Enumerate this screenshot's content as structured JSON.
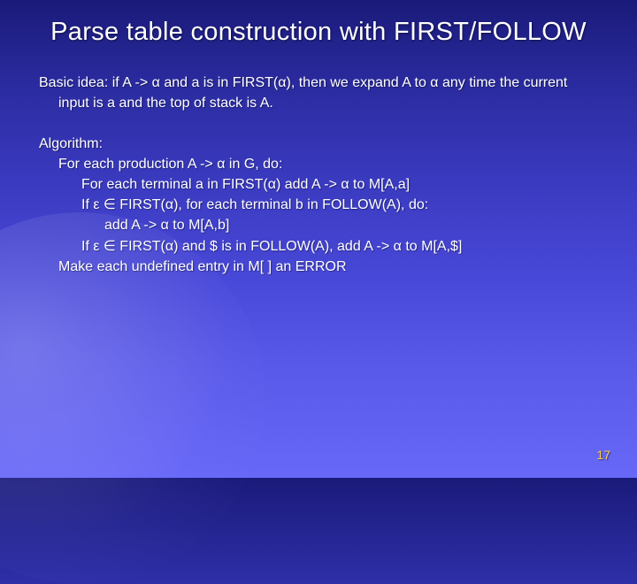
{
  "slide": {
    "title": "Parse table construction with FIRST/FOLLOW",
    "basic_idea": "Basic idea: if A -> α and a is in FIRST(α), then we expand A to α any time the current input is a and the top of stack is A.",
    "algorithm": {
      "heading": "Algorithm:",
      "line1": "For each production A -> α in G, do:",
      "line2": "For each terminal a in FIRST(α) add A -> α to M[A,a]",
      "line3": "If ε ∈ FIRST(α), for each terminal b in FOLLOW(A), do:",
      "line4": "add A -> α to M[A,b]",
      "line5": "If ε ∈ FIRST(α) and $ is in FOLLOW(A), add A -> α to M[A,$]",
      "line6": "Make each undefined entry in M[ ] an ERROR"
    },
    "page_number": "17"
  }
}
